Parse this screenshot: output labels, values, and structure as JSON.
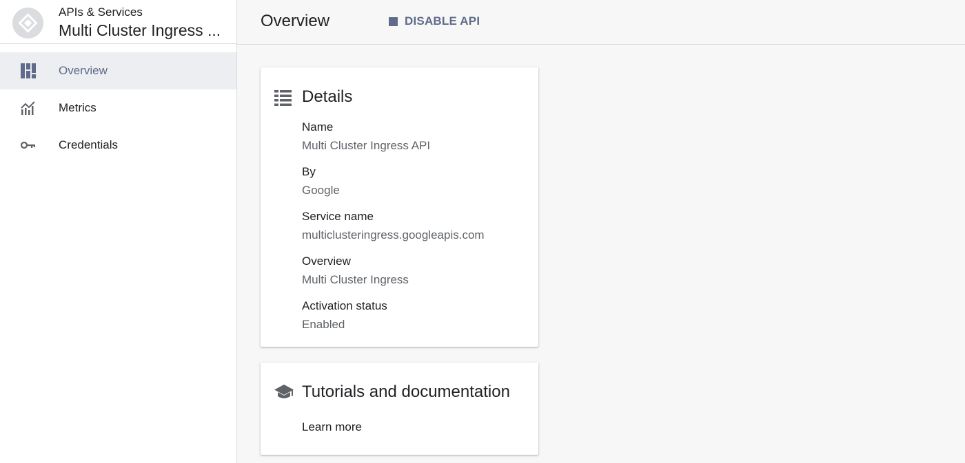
{
  "sidebar": {
    "subtitle": "APIs & Services",
    "title": "Multi Cluster Ingress ...",
    "items": [
      {
        "label": "Overview",
        "icon": "dashboard-icon",
        "active": true
      },
      {
        "label": "Metrics",
        "icon": "metrics-chart-icon",
        "active": false
      },
      {
        "label": "Credentials",
        "icon": "key-icon",
        "active": false
      }
    ]
  },
  "header": {
    "title": "Overview",
    "disable_label": "DISABLE API"
  },
  "details": {
    "title": "Details",
    "fields": [
      {
        "label": "Name",
        "value": "Multi Cluster Ingress API"
      },
      {
        "label": "By",
        "value": "Google"
      },
      {
        "label": "Service name",
        "value": "multiclusteringress.googleapis.com"
      },
      {
        "label": "Overview",
        "value": "Multi Cluster Ingress"
      },
      {
        "label": "Activation status",
        "value": "Enabled"
      }
    ]
  },
  "tutorials": {
    "title": "Tutorials and documentation",
    "link_label": "Learn more"
  },
  "colors": {
    "accent": "#5f6b8a",
    "active_nav_bg": "#eceef2",
    "page_bg": "#f7f7f7",
    "secondary_text": "#5f6368"
  }
}
